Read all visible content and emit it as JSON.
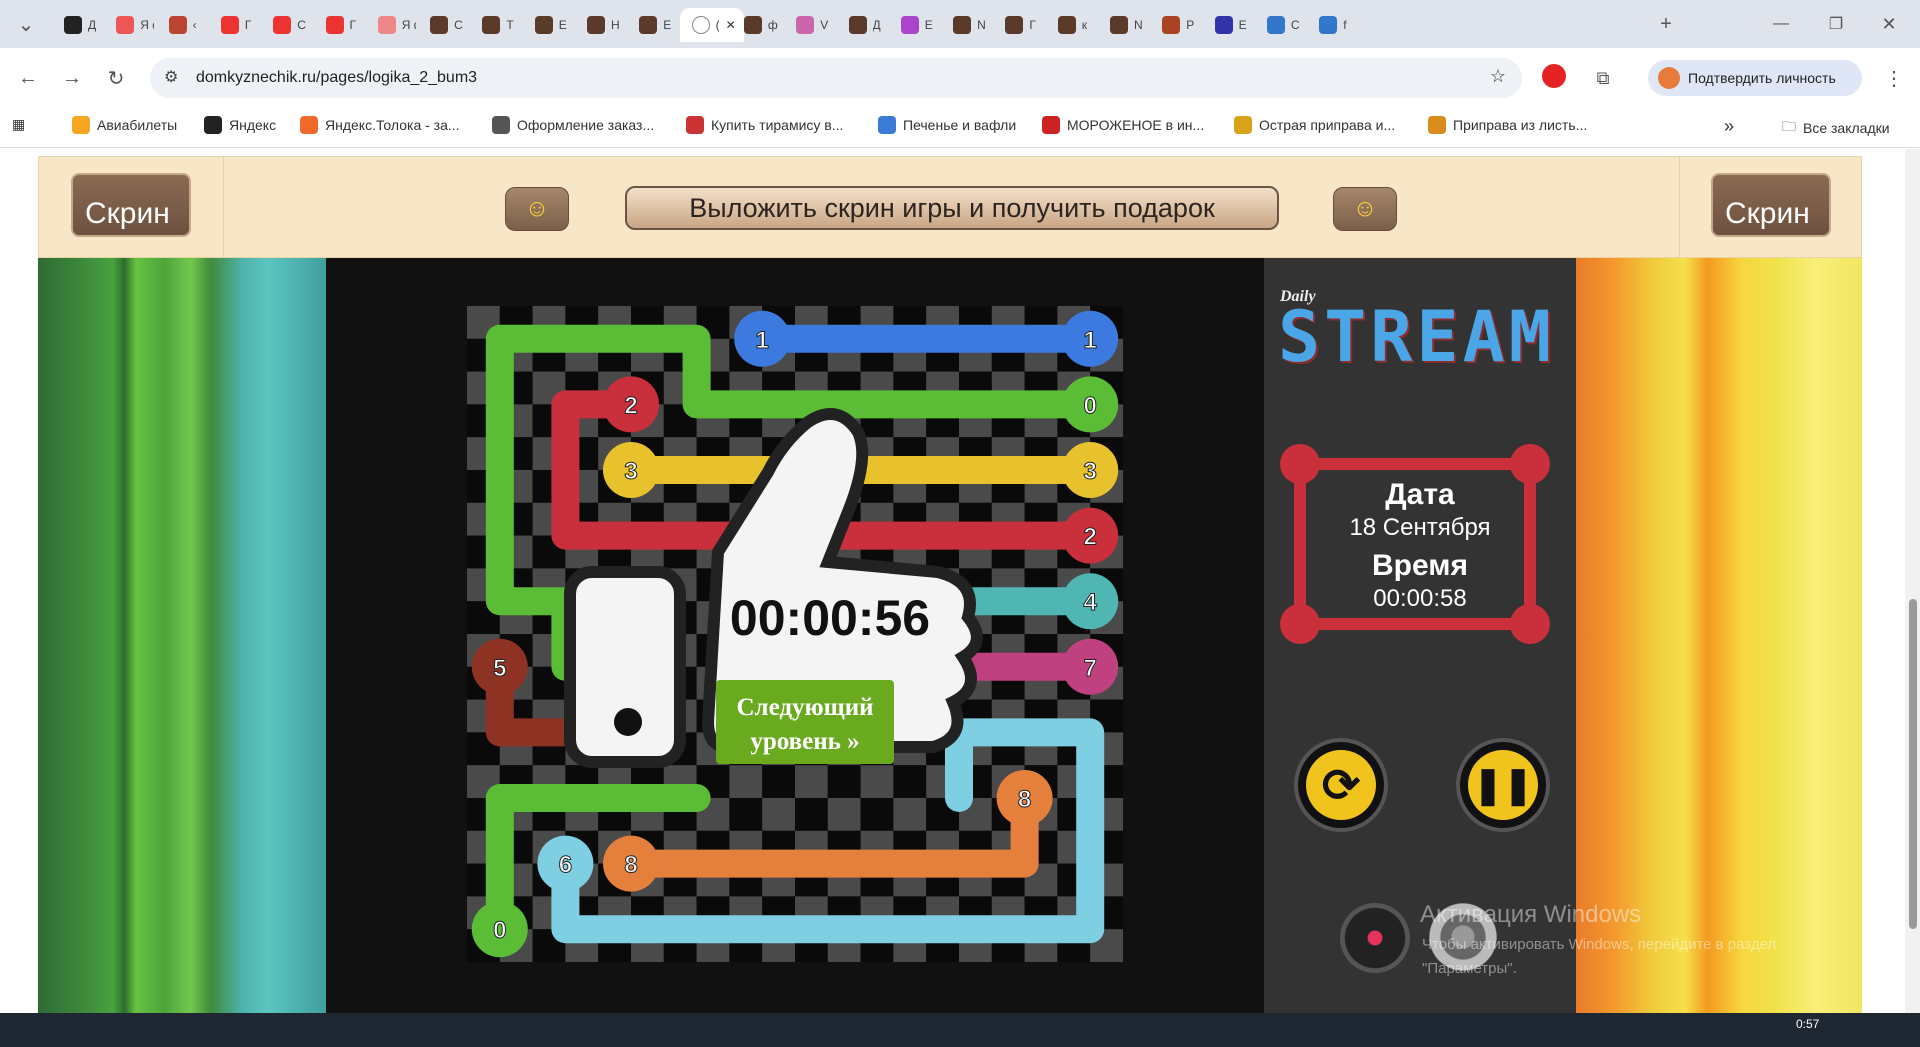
{
  "browser": {
    "tabs": [
      {
        "label": "Д",
        "color": "#222"
      },
      {
        "label": "Я ф",
        "color": "#e55"
      },
      {
        "label": "‹",
        "color": "#b43"
      },
      {
        "label": "Г",
        "color": "#e33"
      },
      {
        "label": "С",
        "color": "#e33"
      },
      {
        "label": "Г",
        "color": "#e33"
      },
      {
        "label": "Я ф",
        "color": "#e88"
      },
      {
        "label": "С",
        "color": "#5b3a2a"
      },
      {
        "label": "Т",
        "color": "#5b3a2a"
      },
      {
        "label": "Е",
        "color": "#5b3a2a"
      },
      {
        "label": "Н",
        "color": "#5b3a2a"
      },
      {
        "label": "Е",
        "color": "#5b3a2a"
      },
      {
        "label": "(",
        "color": "#fff",
        "active": true
      },
      {
        "label": "ф",
        "color": "#5b3a2a"
      },
      {
        "label": "V",
        "color": "#c6a"
      },
      {
        "label": "Д",
        "color": "#5b3a2a"
      },
      {
        "label": "Е",
        "color": "#a4c"
      },
      {
        "label": "Ν",
        "color": "#5b3a2a"
      },
      {
        "label": "Г",
        "color": "#5b3a2a"
      },
      {
        "label": "к",
        "color": "#5b3a2a"
      },
      {
        "label": "Ν",
        "color": "#5b3a2a"
      },
      {
        "label": "Р",
        "color": "#a42"
      },
      {
        "label": "Е",
        "color": "#33a"
      },
      {
        "label": "С",
        "color": "#37c"
      },
      {
        "label": "f",
        "color": "#37c"
      }
    ],
    "url": "domkyznechik.ru/pages/logika_2_bum3",
    "verify_label": "Подтвердить личность",
    "bookmarks": [
      {
        "label": "Авиабилеты",
        "color": "#f5a623"
      },
      {
        "label": "Яндекс",
        "color": "#222"
      },
      {
        "label": "Яндекс.Толока - за...",
        "color": "#f06a2b"
      },
      {
        "label": "Оформление заказ...",
        "color": "#555"
      },
      {
        "label": "Купить тирамису в...",
        "color": "#c33"
      },
      {
        "label": "Печенье и вафли",
        "color": "#3a7bd5"
      },
      {
        "label": "МОРОЖЕНОЕ в ин...",
        "color": "#c22"
      },
      {
        "label": "Острая приправа и...",
        "color": "#d9a21b"
      },
      {
        "label": "Приправа из листь...",
        "color": "#d98c1b"
      }
    ],
    "all_bookmarks": "Все закладки"
  },
  "banner": {
    "screen_left": "Скрин",
    "screen_right": "Скрин",
    "share_text": "Выложить скрин игры и получить подарок"
  },
  "game": {
    "brand_small": "Daily",
    "brand_big": "STREAM",
    "date_label": "Дата",
    "date_value": "18 Сентября",
    "time_label": "Время",
    "time_value": "00:00:58",
    "overlay_time": "00:00:56",
    "next_level": [
      "Следующий",
      "уровень »"
    ],
    "colors": {
      "green": "#5bbd35",
      "blue": "#3d7ae0",
      "red": "#c9303c",
      "yellow": "#e8c22c",
      "teal": "#4fb6b3",
      "magenta": "#c0417f",
      "brown": "#8e3324",
      "lightblue": "#7fcfe3",
      "orange": "#e57f3c"
    },
    "nodes": [
      {
        "label": "1",
        "color": "blue"
      },
      {
        "label": "1",
        "color": "blue"
      },
      {
        "label": "2",
        "color": "red"
      },
      {
        "label": "0",
        "color": "green"
      },
      {
        "label": "3",
        "color": "yellow"
      },
      {
        "label": "3",
        "color": "yellow"
      },
      {
        "label": "2",
        "color": "red"
      },
      {
        "label": "4",
        "color": "teal"
      },
      {
        "label": "5",
        "color": "brown"
      },
      {
        "label": "7",
        "color": "magenta"
      },
      {
        "label": "8",
        "color": "orange"
      },
      {
        "label": "6",
        "color": "lightblue"
      },
      {
        "label": "8",
        "color": "orange"
      },
      {
        "label": "0",
        "color": "green"
      }
    ]
  },
  "os": {
    "watermark_title": "Активация Windows",
    "watermark_text_1": "Чтобы активировать Windows, перейдите в раздел",
    "watermark_text_2": "\"Параметры\".",
    "clock": "0:57"
  }
}
